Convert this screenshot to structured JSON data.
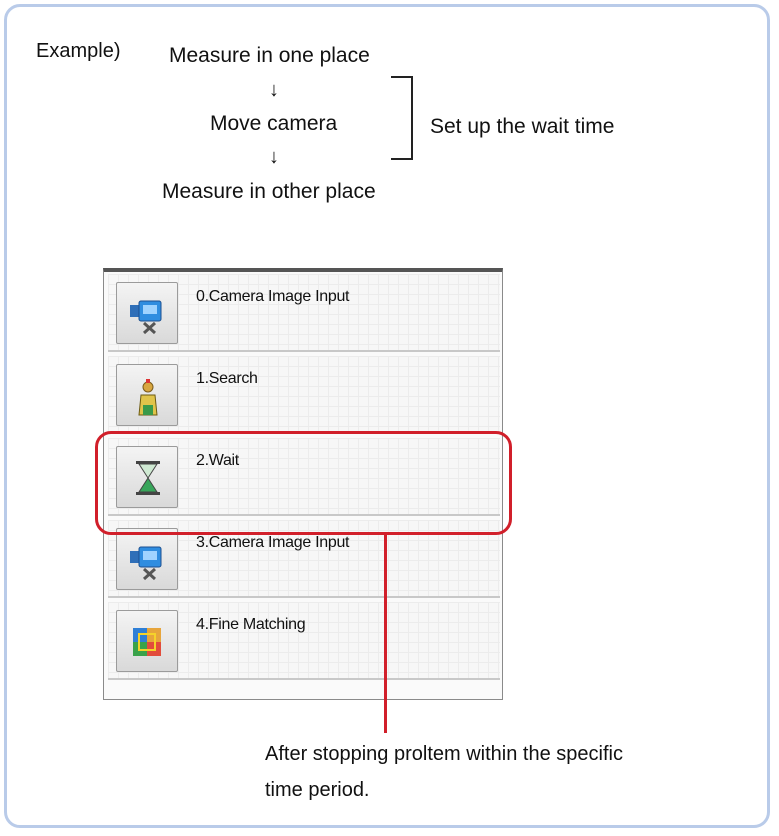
{
  "example_label": "Example)",
  "flow": {
    "step1": "Measure in one place",
    "step2": "Move camera",
    "step3": "Measure in other place",
    "arrow": "↓",
    "bracket_label": "Set up the wait time"
  },
  "scene_items": [
    {
      "label": "0.Camera Image Input",
      "icon": "camera-icon"
    },
    {
      "label": "1.Search",
      "icon": "search-figure-icon"
    },
    {
      "label": "2.Wait",
      "icon": "hourglass-icon"
    },
    {
      "label": "3.Camera Image Input",
      "icon": "camera-icon"
    },
    {
      "label": "4.Fine Matching",
      "icon": "fine-matching-icon"
    }
  ],
  "highlight_color": "#d11f2a",
  "note_lines": [
    "After stopping proltem within the specific",
    "time period."
  ]
}
